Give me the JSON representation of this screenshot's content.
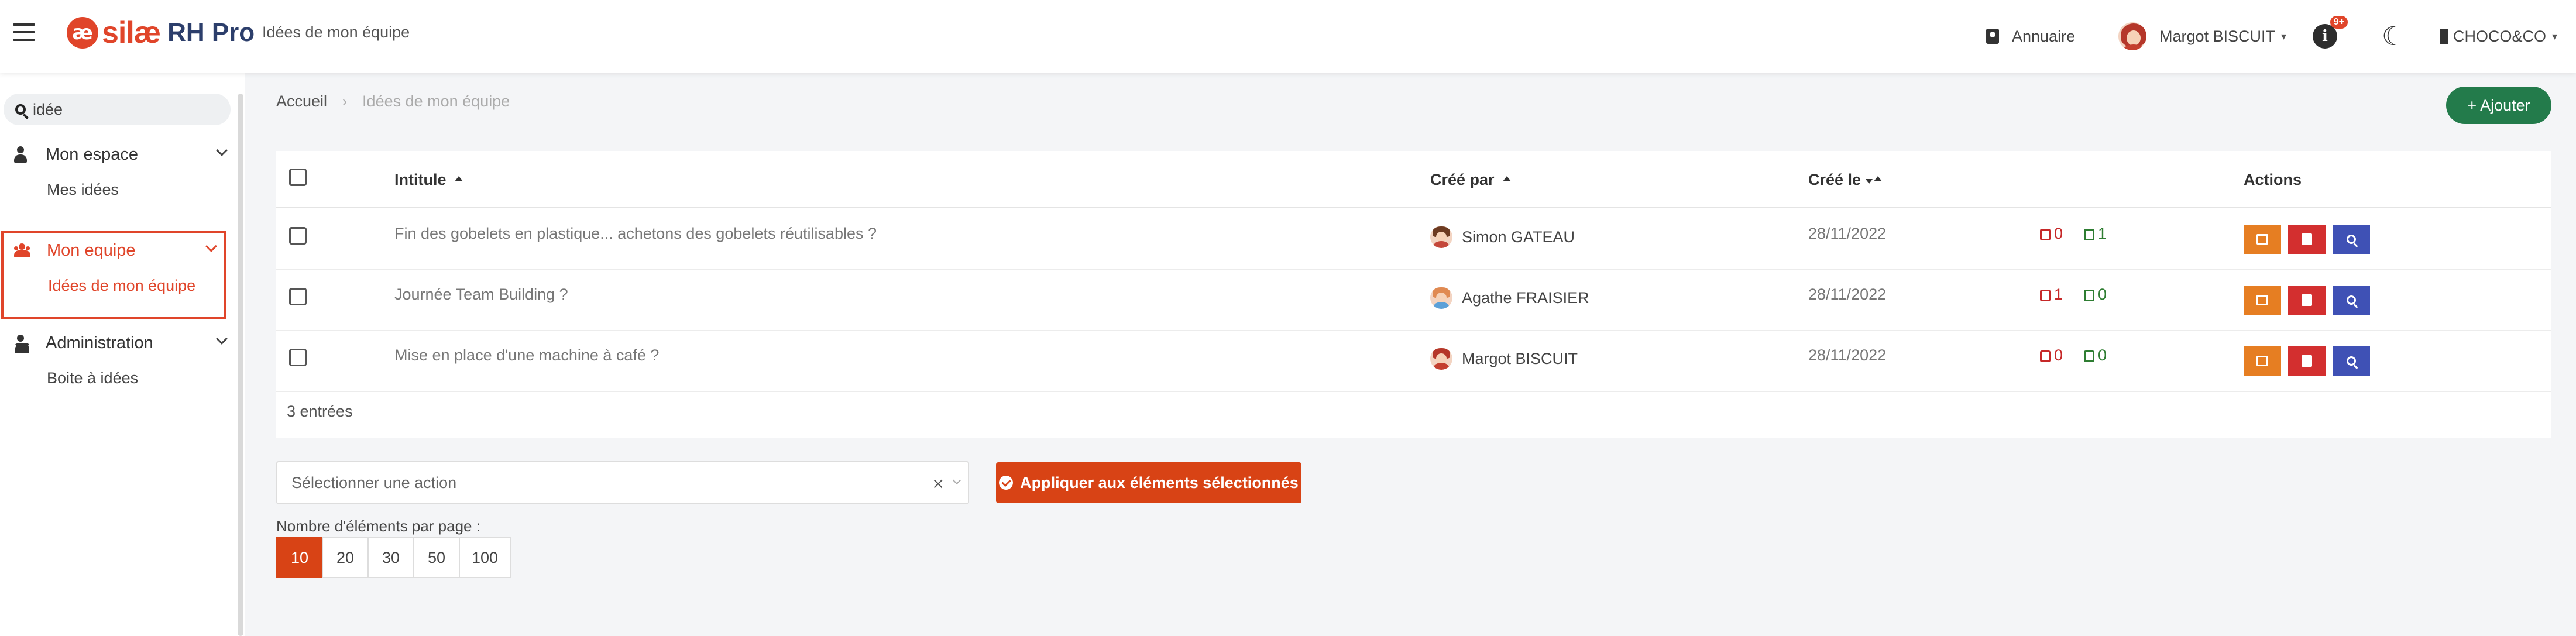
{
  "header": {
    "logo_mark": "æ",
    "logo_name": "silæ",
    "logo_suffix": "RH Pro",
    "page_title": "Idées de mon équipe",
    "directory_label": "Annuaire",
    "user_name": "Margot BISCUIT",
    "notifications_badge": "9+",
    "notifications_glyph": "i",
    "theme_glyph": "☾",
    "company": "CHOCO&CO"
  },
  "sidebar": {
    "search_value": "idée",
    "groups": [
      {
        "label": "Mon espace",
        "items": [
          "Mes idées"
        ]
      },
      {
        "label": "Mon equipe",
        "items": [
          "Idées de mon équipe"
        ],
        "active": true
      },
      {
        "label": "Administration",
        "items": [
          "Boite à idées"
        ]
      }
    ]
  },
  "breadcrumb": {
    "home": "Accueil",
    "separator": "›",
    "current": "Idées de mon équipe"
  },
  "add_button": "+ Ajouter",
  "table": {
    "columns": {
      "title": "Intitule",
      "created_by": "Créé par",
      "created_on": "Créé le",
      "actions": "Actions"
    },
    "rows": [
      {
        "title": "Fin des gobelets en plastique... achetons des gobelets réutilisables ?",
        "author": "Simon GATEAU",
        "date": "28/11/2022",
        "down": "0",
        "up": "1"
      },
      {
        "title": "Journée Team Building ?",
        "author": "Agathe FRAISIER",
        "date": "28/11/2022",
        "down": "1",
        "up": "0"
      },
      {
        "title": "Mise en place d'une machine à café ?",
        "author": "Margot BISCUIT",
        "date": "28/11/2022",
        "down": "0",
        "up": "0"
      }
    ],
    "count": "3 entrées"
  },
  "bulk": {
    "select_placeholder": "Sélectionner une action",
    "clear_glyph": "×",
    "apply_label": "Appliquer aux éléments sélectionnés"
  },
  "pagination": {
    "label": "Nombre d'éléments par page :",
    "sizes": [
      "10",
      "20",
      "30",
      "50",
      "100"
    ],
    "selected": "10"
  },
  "colors": {
    "brand": "#e0452a",
    "success": "#237b4b",
    "edit": "#e67e22",
    "delete": "#d32f2f",
    "view": "#3f51b5"
  }
}
